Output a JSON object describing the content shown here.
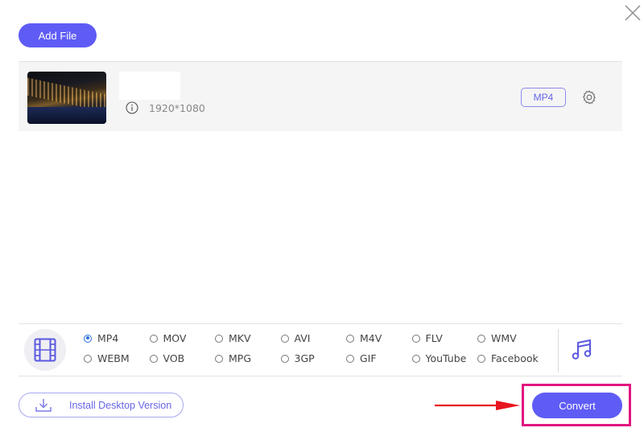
{
  "header": {
    "add_file_label": "Add File",
    "close_icon": "close-icon"
  },
  "file_list": {
    "items": [
      {
        "thumbnail": "night-city-harbor-thumbnail",
        "name": "",
        "resolution": "1920*1080",
        "info_icon": "info-icon",
        "output_format": "MP4",
        "settings_icon": "gear-icon"
      }
    ]
  },
  "format_panel": {
    "video_icon": "film-icon",
    "audio_icon": "music-note-icon",
    "selected": "MP4",
    "options": [
      {
        "label": "MP4",
        "selected": true
      },
      {
        "label": "MOV",
        "selected": false
      },
      {
        "label": "MKV",
        "selected": false
      },
      {
        "label": "AVI",
        "selected": false
      },
      {
        "label": "M4V",
        "selected": false
      },
      {
        "label": "FLV",
        "selected": false
      },
      {
        "label": "WMV",
        "selected": false
      },
      {
        "label": "WEBM",
        "selected": false
      },
      {
        "label": "VOB",
        "selected": false
      },
      {
        "label": "MPG",
        "selected": false
      },
      {
        "label": "3GP",
        "selected": false
      },
      {
        "label": "GIF",
        "selected": false
      },
      {
        "label": "YouTube",
        "selected": false
      },
      {
        "label": "Facebook",
        "selected": false
      }
    ]
  },
  "footer": {
    "install_label": "Install Desktop Version",
    "convert_label": "Convert",
    "annotation_arrow_color": "#e8151f",
    "highlight_color": "#e2157f"
  },
  "colors": {
    "accent": "#5e5cf5",
    "accent_text": "#6765e8",
    "radio_selected": "#2a6ed8"
  }
}
